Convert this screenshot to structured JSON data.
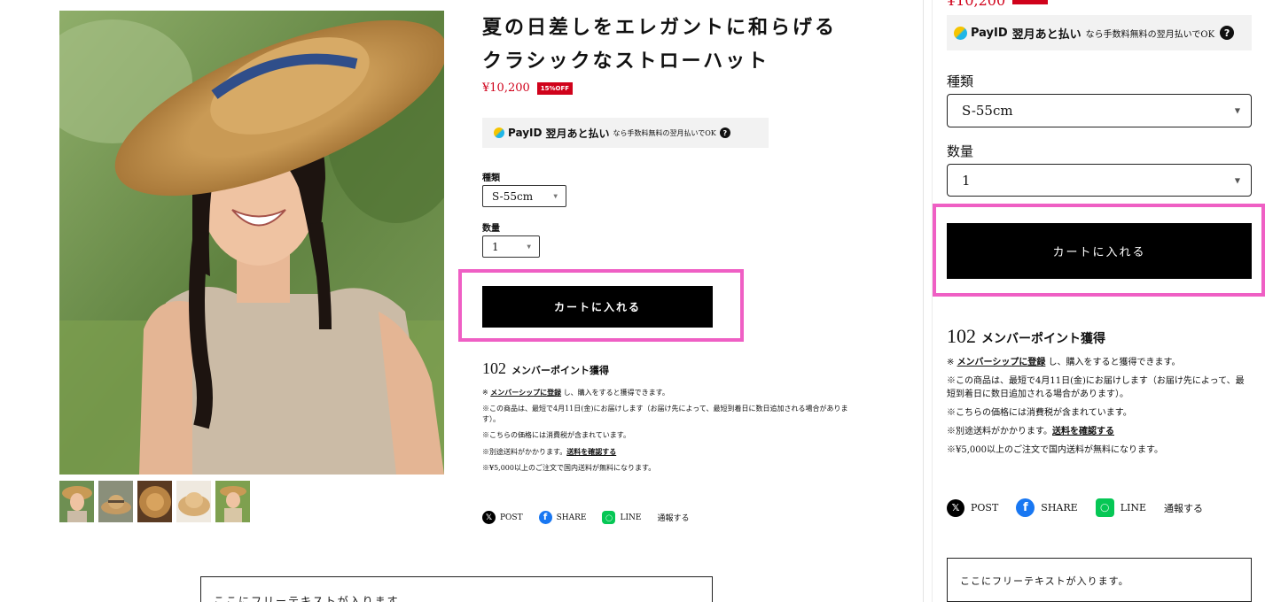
{
  "product": {
    "title": "夏の日差しをエレガントに和らげるクラシックなストローハット",
    "price": "¥10,200",
    "discount_badge": "15%OFF",
    "price_color": "#d0021b"
  },
  "payid": {
    "brand": "PayID",
    "label": "翌月あと払い",
    "note": "なら手数料無料の翌月払いでOK",
    "help_icon": "?"
  },
  "options": {
    "type_label": "種類",
    "type_value": "S-55cm",
    "qty_label": "数量",
    "qty_value": "1"
  },
  "cart_button": {
    "label": "カートに入れる"
  },
  "points": {
    "value": "102",
    "label": "メンバーポイント獲得"
  },
  "notes": {
    "n1_prefix": "※ ",
    "n1_link": "メンバーシップに登録",
    "n1_suffix": " し、購入をすると獲得できます。",
    "n2": "※この商品は、最短で4月11日(金)にお届けします（お届け先によって、最短到着日に数日追加される場合があります）。",
    "n3": "※こちらの価格には消費税が含まれています。",
    "n4_prefix": "※別途送料がかかります。",
    "n4_link": "送料を確認する",
    "n5": "※¥5,000以上のご注文で国内送料が無料になります。"
  },
  "share": {
    "x_icon": "x-icon",
    "x_label": "POST",
    "fb_icon": "facebook-icon",
    "fb_label": "SHARE",
    "line_icon": "line-icon",
    "line_label": "LINE",
    "report_label": "通報する"
  },
  "free_text": "ここにフリーテキストが入ります。",
  "highlight_color": "#ef5fc4"
}
